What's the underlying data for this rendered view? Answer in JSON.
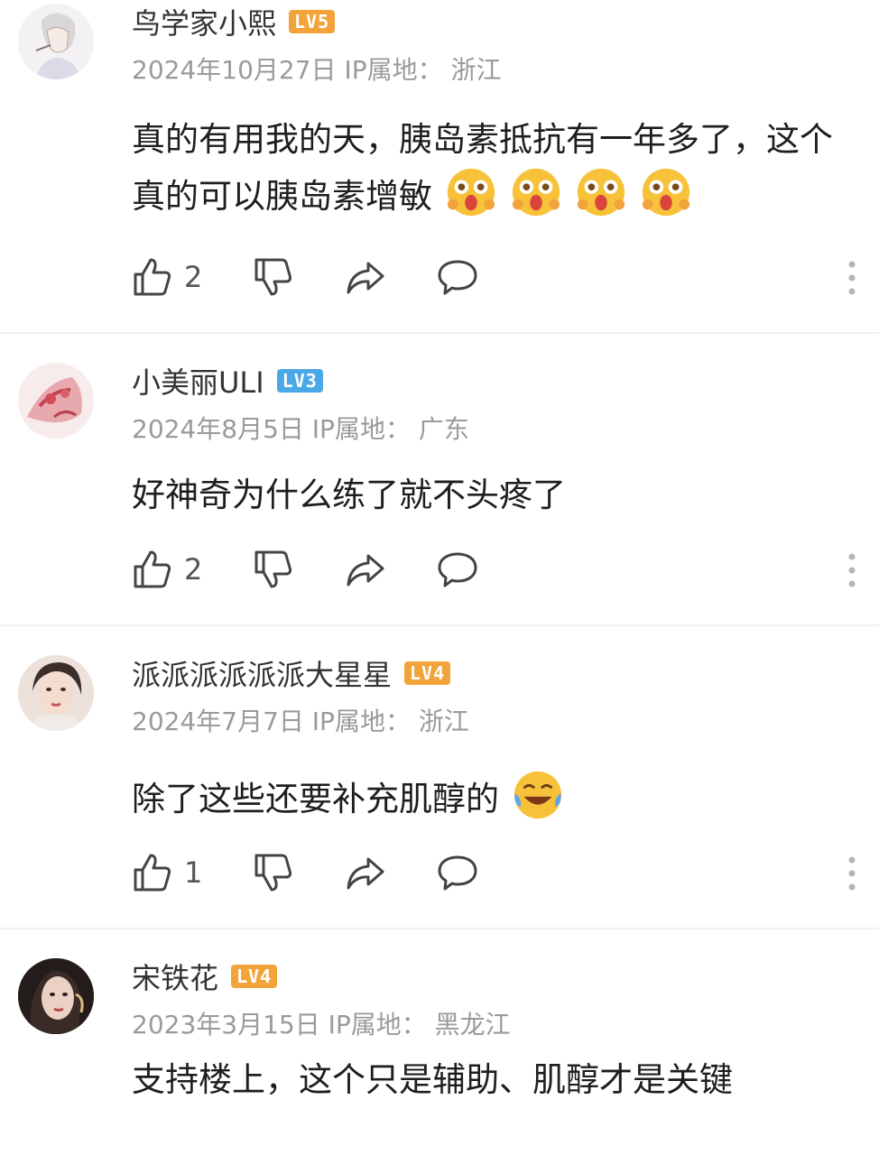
{
  "comments": [
    {
      "username": "鸟学家小熙",
      "level": "LV5",
      "level_color": "#f2a33a",
      "date": "2024年10月27日",
      "ip_label": "IP属地：",
      "ip_location": "浙江",
      "text": "真的有用我的天，胰岛素抵抗有一年多了，这个真的可以胰岛素增敏",
      "emojis": [
        "starstruck-emoji",
        "starstruck-emoji",
        "starstruck-emoji",
        "starstruck-emoji"
      ],
      "likes": "2"
    },
    {
      "username": "小美丽ULI",
      "level": "LV3",
      "level_color": "#4aa8e8",
      "date": "2024年8月5日",
      "ip_label": "IP属地：",
      "ip_location": "广东",
      "text": "好神奇为什么练了就不头疼了",
      "emojis": [],
      "likes": "2"
    },
    {
      "username": "派派派派派派大星星",
      "level": "LV4",
      "level_color": "#f2a33a",
      "date": "2024年7月7日",
      "ip_label": "IP属地：",
      "ip_location": "浙江",
      "text": "除了这些还要补充肌醇的",
      "emojis": [
        "laughing-tears-emoji"
      ],
      "likes": "1"
    },
    {
      "username": "宋铁花",
      "level": "LV4",
      "level_color": "#f2a33a",
      "date": "2023年3月15日",
      "ip_label": "IP属地：",
      "ip_location": "黑龙江",
      "text": "支持楼上，这个只是辅助、肌醇才是关键",
      "emojis": [],
      "likes": ""
    }
  ],
  "icons": [
    "thumbs-up-icon",
    "thumbs-down-icon",
    "share-icon",
    "reply-icon",
    "more-icon"
  ]
}
